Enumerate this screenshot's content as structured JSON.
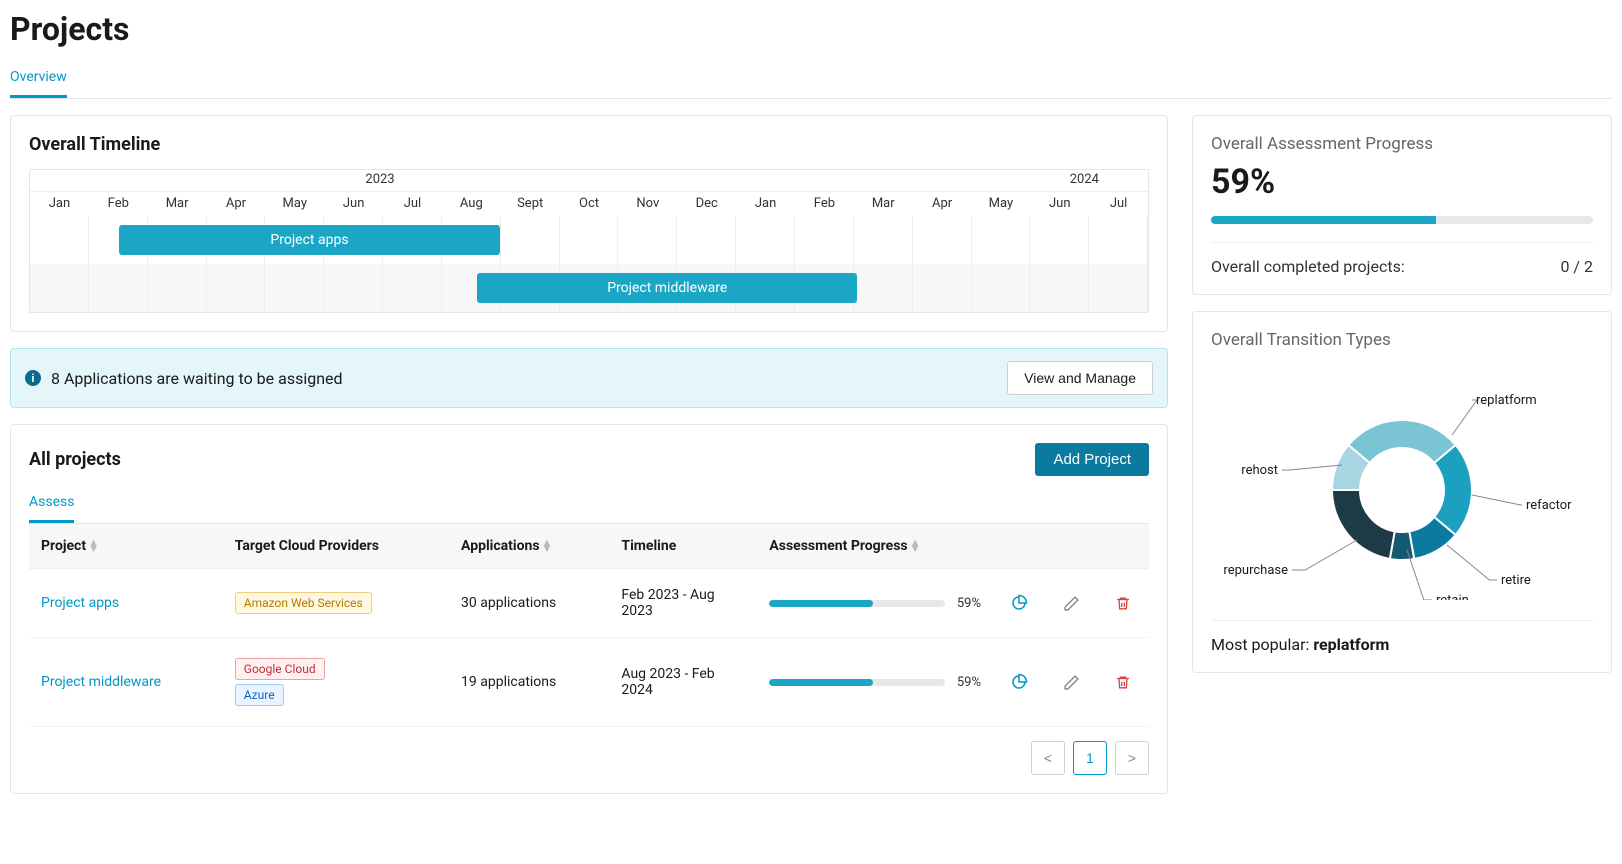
{
  "page_title": "Projects",
  "tab_overview": "Overview",
  "timeline": {
    "title": "Overall Timeline",
    "years": [
      "2023",
      "2024"
    ],
    "months": [
      "Jan",
      "Feb",
      "Mar",
      "Apr",
      "May",
      "Jun",
      "Jul",
      "Aug",
      "Sept",
      "Oct",
      "Nov",
      "Dec",
      "Jan",
      "Feb",
      "Mar",
      "Apr",
      "May",
      "Jun",
      "Jul"
    ],
    "bars": [
      {
        "label": "Project apps",
        "start_pct": 8,
        "width_pct": 34
      },
      {
        "label": "Project middleware",
        "start_pct": 40,
        "width_pct": 34
      }
    ]
  },
  "alert": {
    "text": "8 Applications are waiting to be assigned",
    "button": "View and Manage"
  },
  "projects": {
    "title": "All projects",
    "add_button": "Add Project",
    "subtab": "Assess",
    "columns": {
      "project": "Project",
      "providers": "Target Cloud Providers",
      "applications": "Applications",
      "timeline": "Timeline",
      "progress": "Assessment Progress"
    },
    "rows": [
      {
        "name": "Project apps",
        "providers": [
          {
            "label": "Amazon Web Services",
            "cls": "tag-aws"
          }
        ],
        "applications": "30 applications",
        "timeline": "Feb 2023 - Aug 2023",
        "progress_pct": 59,
        "progress_label": "59%"
      },
      {
        "name": "Project middleware",
        "providers": [
          {
            "label": "Google Cloud",
            "cls": "tag-gcp"
          },
          {
            "label": "Azure",
            "cls": "tag-azure"
          }
        ],
        "applications": "19 applications",
        "timeline": "Aug 2023 - Feb 2024",
        "progress_pct": 59,
        "progress_label": "59%"
      }
    ],
    "page": "1"
  },
  "assessment": {
    "title": "Overall Assessment Progress",
    "pct_label": "59%",
    "pct": 59,
    "completed_label": "Overall completed projects:",
    "completed_value": "0 / 2"
  },
  "transitions": {
    "title": "Overall Transition Types",
    "popular_label": "Most popular: ",
    "popular_value": "replatform"
  },
  "chart_data": {
    "type": "pie",
    "title": "Overall Transition Types",
    "series": [
      {
        "name": "replatform",
        "value": 25
      },
      {
        "name": "refactor",
        "value": 20
      },
      {
        "name": "retire",
        "value": 10
      },
      {
        "name": "retain",
        "value": 5
      },
      {
        "name": "repurchase",
        "value": 20
      },
      {
        "name": "rehost",
        "value": 10
      }
    ]
  }
}
